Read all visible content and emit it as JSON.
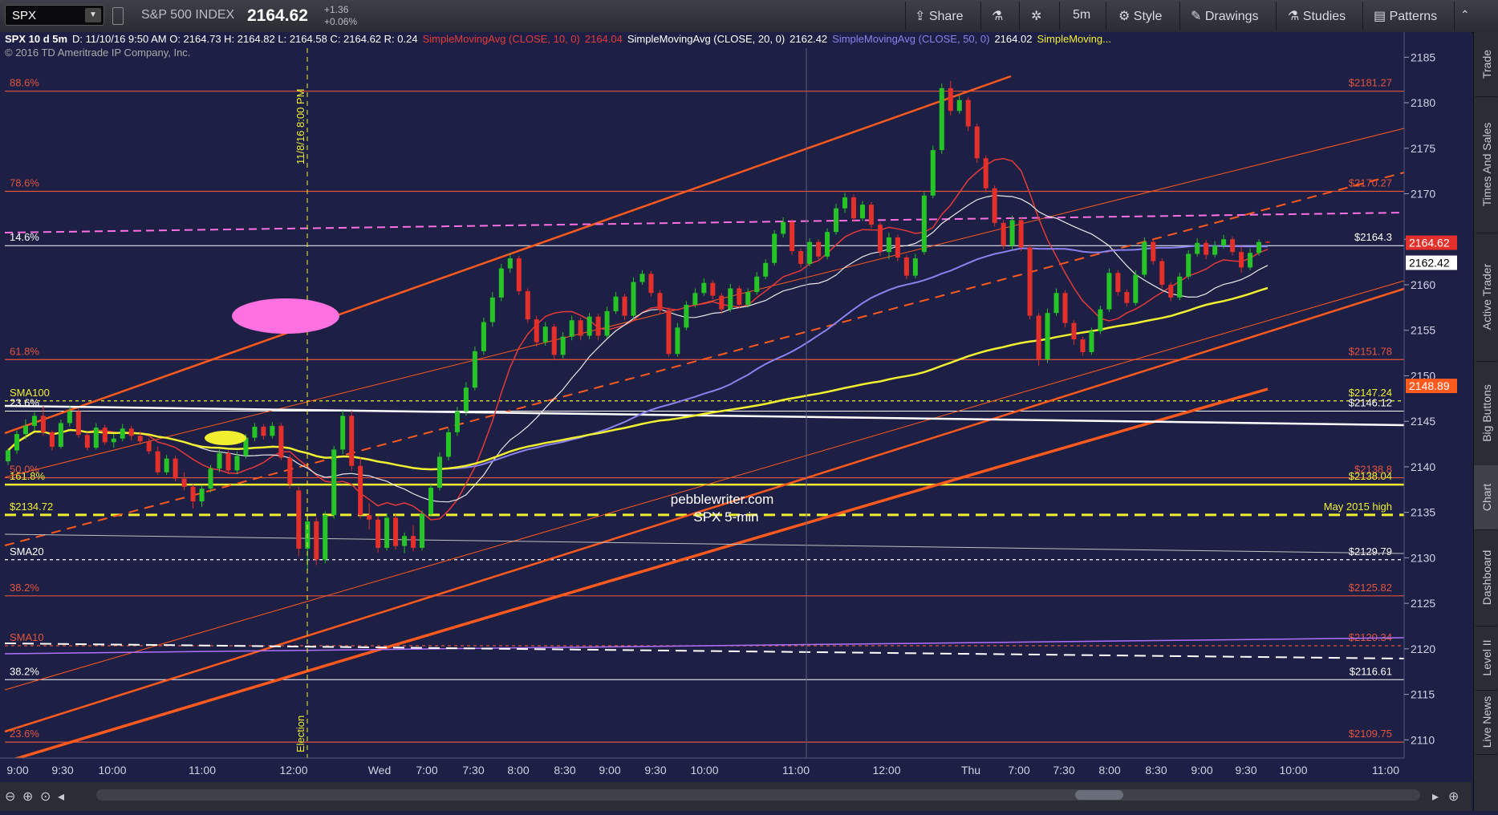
{
  "toolbar": {
    "symbol": "SPX",
    "name": "S&P 500 INDEX",
    "price": "2164.62",
    "change": "+1.36",
    "change_pct": "+0.06%",
    "share_label": "Share",
    "timeframe": "5m",
    "style_label": "Style",
    "drawings_label": "Drawings",
    "studies_label": "Studies",
    "patterns_label": "Patterns"
  },
  "header": {
    "desc": "SPX 10 d 5m",
    "ohlc": "D: 11/10/16 9:50 AM  O: 2164.73  H: 2164.82  L: 2164.58  C: 2164.62  R: 0.24",
    "sma10_label": "SimpleMovingAvg (CLOSE, 10, 0)",
    "sma10_value": "2164.04",
    "sma20_label": "SimpleMovingAvg (CLOSE, 20, 0)",
    "sma20_value": "2162.42",
    "sma50_label": "SimpleMovingAvg (CLOSE, 50, 0)",
    "sma50_value": "2164.02",
    "sma_more": "SimpleMoving...",
    "copyright": "2016 © TD Ameritrade IP Company, Inc."
  },
  "right_tabs": [
    "Trade",
    "Times And Sales",
    "Active Trader",
    "Big Buttons",
    "Chart",
    "Dashboard",
    "Level II",
    "Live News"
  ],
  "colors": {
    "background": "#1d1f45",
    "up": "#27c427",
    "down": "#e3302a",
    "sma10": "#e53a3a",
    "sma20": "#e8e8e8",
    "sma50": "#8a82ee",
    "sma100": "#f0f030",
    "channel": "#ff5a1e",
    "fib": "#e05540",
    "pink": "#ff70e0"
  },
  "chart_data": {
    "type": "candlestick",
    "title": "SPX 10 d 5m",
    "watermark": [
      "pebblewriter.com",
      "SPX 5-min"
    ],
    "ylim": [
      2108,
      2186
    ],
    "y_ticks": [
      2110,
      2115,
      2120,
      2125,
      2130,
      2135,
      2140,
      2145,
      2150,
      2155,
      2160,
      2165,
      2170,
      2175,
      2180,
      2185
    ],
    "x_ticks": [
      "9:00",
      "9:30",
      "10:00",
      "11:00",
      "12:00",
      "Wed",
      "7:00",
      "7:30",
      "8:00",
      "8:30",
      "9:00",
      "9:30",
      "10:00",
      "11:00",
      "12:00",
      "Thu",
      "7:00",
      "7:30",
      "8:00",
      "8:30",
      "9:00",
      "9:30",
      "10:00",
      "11:00"
    ],
    "price_badges": [
      {
        "label": "2164.62",
        "value": 2164.62,
        "style": "last"
      },
      {
        "label": "2162.42",
        "value": 2162.42,
        "style": "sma20"
      },
      {
        "label": "2148.89",
        "value": 2148.89,
        "style": "channel"
      }
    ],
    "levels": [
      {
        "left": "88.6%",
        "right": "$2181.27",
        "value": 2181.27,
        "color": "#e05540"
      },
      {
        "left": "78.6%",
        "right": "$2170.27",
        "value": 2170.27,
        "color": "#e05540"
      },
      {
        "left": "14.6%",
        "right": "$2164.3",
        "value": 2164.3,
        "color": "#ffffff"
      },
      {
        "left": "61.8%",
        "right": "$2151.78",
        "value": 2151.78,
        "color": "#e05540"
      },
      {
        "left": "SMA100",
        "right": "$2147.24",
        "value": 2147.24,
        "color": "#f0f030"
      },
      {
        "left": "23.6%",
        "right": "$2146.12",
        "value": 2146.12,
        "color": "#ffffff"
      },
      {
        "left": "50.0%",
        "right": "$2138.8",
        "value": 2138.8,
        "color": "#e05540"
      },
      {
        "left": "161.8%",
        "right": "$2138.04",
        "value": 2138.04,
        "color": "#f0f030"
      },
      {
        "left": "$2134.72",
        "right": "May 2015 high",
        "value": 2134.72,
        "color": "#f0f030"
      },
      {
        "left": "SMA20",
        "right": "$2129.79",
        "value": 2129.79,
        "color": "#ffffff"
      },
      {
        "left": "38.2%",
        "right": "$2125.82",
        "value": 2125.82,
        "color": "#e05540"
      },
      {
        "left": "SMA10",
        "right": "$2120.34",
        "value": 2120.34,
        "color": "#e05540"
      },
      {
        "left": "38.2%",
        "right": "$2116.61",
        "value": 2116.61,
        "color": "#ffffff"
      },
      {
        "left": "23.6%",
        "right": "$2109.75",
        "value": 2109.75,
        "color": "#e05540"
      }
    ],
    "annotations": {
      "vline_top": "11/8/16 8:00 PM",
      "vline_bottom": "Election"
    },
    "candles": [
      [
        2140.6,
        2142.0,
        2140.2,
        2141.8
      ],
      [
        2141.8,
        2144.0,
        2141.4,
        2143.6
      ],
      [
        2143.6,
        2145.2,
        2143.0,
        2144.5
      ],
      [
        2144.5,
        2146.0,
        2144.0,
        2145.6
      ],
      [
        2145.6,
        2146.7,
        2143.4,
        2143.8
      ],
      [
        2143.8,
        2144.0,
        2141.8,
        2142.2
      ],
      [
        2142.2,
        2145.2,
        2142.0,
        2144.8
      ],
      [
        2144.8,
        2146.7,
        2144.4,
        2146.1
      ],
      [
        2146.1,
        2146.4,
        2143.2,
        2143.5
      ],
      [
        2143.5,
        2143.8,
        2141.8,
        2142.1
      ],
      [
        2142.1,
        2144.8,
        2141.9,
        2144.3
      ],
      [
        2144.3,
        2144.6,
        2142.4,
        2142.7
      ],
      [
        2142.7,
        2143.6,
        2142.1,
        2143.1
      ],
      [
        2143.1,
        2144.7,
        2142.8,
        2144.2
      ],
      [
        2144.2,
        2144.5,
        2142.9,
        2143.4
      ],
      [
        2143.4,
        2143.9,
        2142.4,
        2142.8
      ],
      [
        2142.8,
        2143.1,
        2141.4,
        2141.7
      ],
      [
        2141.7,
        2142.2,
        2139.1,
        2139.4
      ],
      [
        2139.4,
        2141.3,
        2139.1,
        2140.9
      ],
      [
        2140.9,
        2141.2,
        2138.4,
        2138.7
      ],
      [
        2138.7,
        2139.4,
        2137.4,
        2137.8
      ],
      [
        2137.8,
        2138.1,
        2135.4,
        2136.2
      ],
      [
        2136.2,
        2138.0,
        2135.6,
        2137.6
      ],
      [
        2137.6,
        2140.2,
        2137.2,
        2139.8
      ],
      [
        2139.8,
        2141.9,
        2139.4,
        2141.5
      ],
      [
        2141.5,
        2141.8,
        2139.2,
        2139.6
      ],
      [
        2139.6,
        2141.7,
        2139.2,
        2141.2
      ],
      [
        2141.2,
        2143.6,
        2140.9,
        2143.2
      ],
      [
        2143.2,
        2144.8,
        2142.8,
        2144.4
      ],
      [
        2144.4,
        2144.7,
        2143.0,
        2143.4
      ],
      [
        2143.4,
        2144.9,
        2143.1,
        2144.5
      ],
      [
        2144.5,
        2144.8,
        2140.7,
        2141.0
      ],
      [
        2141.0,
        2141.3,
        2137.6,
        2138.1
      ],
      [
        2137.4,
        2137.8,
        2130.2,
        2131.0
      ],
      [
        2131.0,
        2134.6,
        2128.6,
        2134.0
      ],
      [
        2134.0,
        2134.4,
        2129.2,
        2129.8
      ],
      [
        2129.8,
        2135.1,
        2129.4,
        2134.7
      ],
      [
        2134.7,
        2142.3,
        2134.3,
        2141.9
      ],
      [
        2141.9,
        2146.2,
        2141.4,
        2145.6
      ],
      [
        2145.6,
        2146.2,
        2139.6,
        2140.1
      ],
      [
        2140.1,
        2141.0,
        2134.3,
        2134.7
      ],
      [
        2134.7,
        2136.0,
        2133.1,
        2134.2
      ],
      [
        2134.2,
        2134.6,
        2130.6,
        2131.1
      ],
      [
        2131.1,
        2134.9,
        2130.8,
        2134.4
      ],
      [
        2134.4,
        2134.8,
        2130.9,
        2131.3
      ],
      [
        2131.3,
        2132.8,
        2130.5,
        2132.4
      ],
      [
        2132.4,
        2133.6,
        2130.7,
        2131.1
      ],
      [
        2131.1,
        2135.2,
        2130.8,
        2134.8
      ],
      [
        2134.8,
        2138.1,
        2134.5,
        2137.7
      ],
      [
        2137.7,
        2141.6,
        2137.4,
        2141.1
      ],
      [
        2141.1,
        2144.2,
        2140.7,
        2143.8
      ],
      [
        2143.8,
        2146.6,
        2143.4,
        2146.1
      ],
      [
        2146.1,
        2149.3,
        2145.6,
        2148.7
      ],
      [
        2148.7,
        2153.2,
        2148.4,
        2152.7
      ],
      [
        2152.7,
        2156.4,
        2152.3,
        2155.9
      ],
      [
        2155.9,
        2159.2,
        2155.4,
        2158.6
      ],
      [
        2158.6,
        2162.3,
        2158.2,
        2161.8
      ],
      [
        2161.8,
        2163.5,
        2161.3,
        2162.9
      ],
      [
        2162.9,
        2163.2,
        2158.9,
        2159.3
      ],
      [
        2159.3,
        2159.6,
        2155.8,
        2156.2
      ],
      [
        2156.2,
        2156.6,
        2153.2,
        2153.7
      ],
      [
        2153.7,
        2155.9,
        2153.3,
        2155.4
      ],
      [
        2155.4,
        2155.7,
        2151.8,
        2152.3
      ],
      [
        2152.3,
        2154.8,
        2151.9,
        2154.3
      ],
      [
        2154.3,
        2156.6,
        2153.9,
        2156.1
      ],
      [
        2156.1,
        2156.4,
        2153.9,
        2154.4
      ],
      [
        2154.4,
        2156.9,
        2154.0,
        2156.5
      ],
      [
        2156.5,
        2156.8,
        2153.9,
        2154.4
      ],
      [
        2154.4,
        2157.6,
        2154.1,
        2157.1
      ],
      [
        2157.1,
        2159.2,
        2156.8,
        2158.7
      ],
      [
        2158.7,
        2159.0,
        2156.1,
        2156.6
      ],
      [
        2156.6,
        2160.8,
        2156.3,
        2160.3
      ],
      [
        2160.3,
        2161.6,
        2160.0,
        2161.2
      ],
      [
        2161.2,
        2161.5,
        2158.7,
        2159.1
      ],
      [
        2159.1,
        2159.4,
        2156.8,
        2157.2
      ],
      [
        2157.2,
        2157.5,
        2152.1,
        2152.4
      ],
      [
        2152.4,
        2155.8,
        2152.1,
        2155.3
      ],
      [
        2155.3,
        2158.2,
        2155.0,
        2157.8
      ],
      [
        2157.8,
        2159.6,
        2157.5,
        2159.1
      ],
      [
        2159.1,
        2160.7,
        2158.8,
        2160.2
      ],
      [
        2160.2,
        2160.5,
        2158.4,
        2158.8
      ],
      [
        2158.8,
        2159.1,
        2156.8,
        2157.3
      ],
      [
        2157.3,
        2160.1,
        2157.0,
        2159.6
      ],
      [
        2159.6,
        2159.9,
        2157.4,
        2157.8
      ],
      [
        2157.8,
        2159.6,
        2157.5,
        2159.2
      ],
      [
        2159.2,
        2161.4,
        2158.9,
        2160.9
      ],
      [
        2160.9,
        2162.8,
        2160.6,
        2162.4
      ],
      [
        2162.4,
        2166.0,
        2162.1,
        2165.6
      ],
      [
        2165.6,
        2167.4,
        2165.2,
        2166.9
      ],
      [
        2166.9,
        2167.2,
        2163.3,
        2163.7
      ],
      [
        2163.7,
        2164.0,
        2161.9,
        2162.3
      ],
      [
        2162.3,
        2165.1,
        2162.0,
        2164.7
      ],
      [
        2164.7,
        2165.0,
        2162.8,
        2163.1
      ],
      [
        2163.1,
        2166.2,
        2162.8,
        2165.8
      ],
      [
        2165.8,
        2168.9,
        2165.5,
        2168.4
      ],
      [
        2168.4,
        2170.1,
        2167.9,
        2169.6
      ],
      [
        2169.6,
        2169.9,
        2166.9,
        2167.3
      ],
      [
        2167.3,
        2169.2,
        2167.0,
        2168.8
      ],
      [
        2168.8,
        2169.1,
        2166.2,
        2166.6
      ],
      [
        2166.6,
        2166.9,
        2163.2,
        2163.6
      ],
      [
        2163.6,
        2165.7,
        2162.8,
        2165.2
      ],
      [
        2165.2,
        2165.5,
        2162.6,
        2163.0
      ],
      [
        2163.0,
        2163.3,
        2160.6,
        2161.0
      ],
      [
        2161.0,
        2163.4,
        2160.7,
        2162.9
      ],
      [
        2163.6,
        2170.2,
        2163.3,
        2169.8
      ],
      [
        2169.8,
        2175.3,
        2169.5,
        2174.8
      ],
      [
        2174.8,
        2182.1,
        2174.4,
        2181.6
      ],
      [
        2181.6,
        2182.4,
        2178.6,
        2179.1
      ],
      [
        2179.1,
        2180.8,
        2178.8,
        2180.3
      ],
      [
        2180.3,
        2180.6,
        2176.9,
        2177.4
      ],
      [
        2177.4,
        2177.7,
        2173.4,
        2173.9
      ],
      [
        2173.9,
        2174.2,
        2170.1,
        2170.6
      ],
      [
        2170.6,
        2170.9,
        2166.4,
        2166.8
      ],
      [
        2166.8,
        2167.1,
        2163.9,
        2164.3
      ],
      [
        2164.3,
        2167.6,
        2163.9,
        2167.1
      ],
      [
        2167.1,
        2167.4,
        2163.7,
        2164.1
      ],
      [
        2164.1,
        2164.4,
        2156.2,
        2156.6
      ],
      [
        2156.6,
        2156.9,
        2151.1,
        2151.8
      ],
      [
        2151.8,
        2157.4,
        2151.4,
        2156.9
      ],
      [
        2156.9,
        2159.6,
        2156.6,
        2159.1
      ],
      [
        2159.1,
        2159.4,
        2155.3,
        2155.8
      ],
      [
        2155.8,
        2156.1,
        2153.4,
        2154.0
      ],
      [
        2154.0,
        2154.3,
        2152.2,
        2152.6
      ],
      [
        2152.6,
        2155.3,
        2152.3,
        2154.9
      ],
      [
        2154.9,
        2157.7,
        2154.6,
        2157.3
      ],
      [
        2157.3,
        2161.8,
        2157.0,
        2161.3
      ],
      [
        2161.3,
        2161.6,
        2158.8,
        2159.2
      ],
      [
        2159.2,
        2159.5,
        2157.6,
        2158.0
      ],
      [
        2158.0,
        2161.6,
        2157.7,
        2161.1
      ],
      [
        2161.1,
        2165.2,
        2160.8,
        2164.7
      ],
      [
        2164.7,
        2165.0,
        2162.2,
        2162.6
      ],
      [
        2162.6,
        2162.9,
        2159.6,
        2160.0
      ],
      [
        2160.0,
        2160.3,
        2158.2,
        2158.6
      ],
      [
        2158.6,
        2161.3,
        2158.3,
        2160.9
      ],
      [
        2160.9,
        2163.8,
        2160.6,
        2163.4
      ],
      [
        2163.4,
        2165.1,
        2163.1,
        2164.6
      ],
      [
        2164.6,
        2164.9,
        2162.8,
        2163.3
      ],
      [
        2163.3,
        2164.8,
        2163.0,
        2164.3
      ],
      [
        2164.3,
        2165.5,
        2164.0,
        2165.0
      ],
      [
        2165.0,
        2165.3,
        2163.2,
        2163.6
      ],
      [
        2163.6,
        2164.2,
        2161.3,
        2161.9
      ],
      [
        2161.9,
        2164.0,
        2161.6,
        2163.5
      ],
      [
        2163.5,
        2165.0,
        2163.2,
        2164.7
      ],
      [
        2164.73,
        2164.82,
        2164.58,
        2164.62
      ]
    ]
  }
}
